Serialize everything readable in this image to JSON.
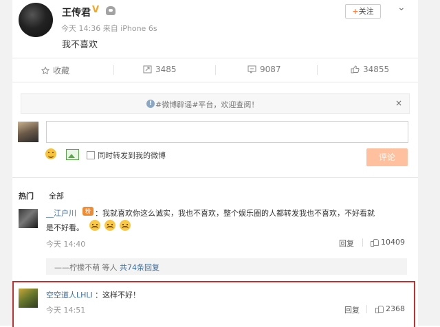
{
  "post": {
    "author": "王传君",
    "meta": "今天 14:36 来自 iPhone 6s",
    "text": "我不喜欢",
    "follow_label": "关注"
  },
  "actions": {
    "favorite": "收藏",
    "repost": "3485",
    "comment": "9087",
    "like": "34855"
  },
  "notice": {
    "text": "#微博辟谣#平台，欢迎查阅！",
    "close": "×"
  },
  "composer": {
    "repost_label": "同时转发到我的微博",
    "submit_label": "评论"
  },
  "tabs": {
    "hot": "热门",
    "all": "全部"
  },
  "comments": [
    {
      "user": "__江户川",
      "text_line1": "：我就喜欢你这么诚实，我也不喜欢，整个娱乐圈的人都转发我也不喜欢，不好看就",
      "text_line2": "是不好看。",
      "time": "今天 14:40",
      "reply": "回复",
      "likes": "10409"
    },
    {
      "user": "空空道人LHLI",
      "text": "：这样不好！",
      "time": "今天 14:51",
      "reply": "回复",
      "likes": "2368"
    }
  ],
  "subreply": {
    "user": "——柠檬不萌",
    "summary": " 等人 ",
    "link": "共74条回复"
  },
  "colors": {
    "accent": "#ff8140",
    "link": "#3b6ea5",
    "highlight_border": "#c62f2f",
    "submit_bg": "#ffc09f"
  }
}
